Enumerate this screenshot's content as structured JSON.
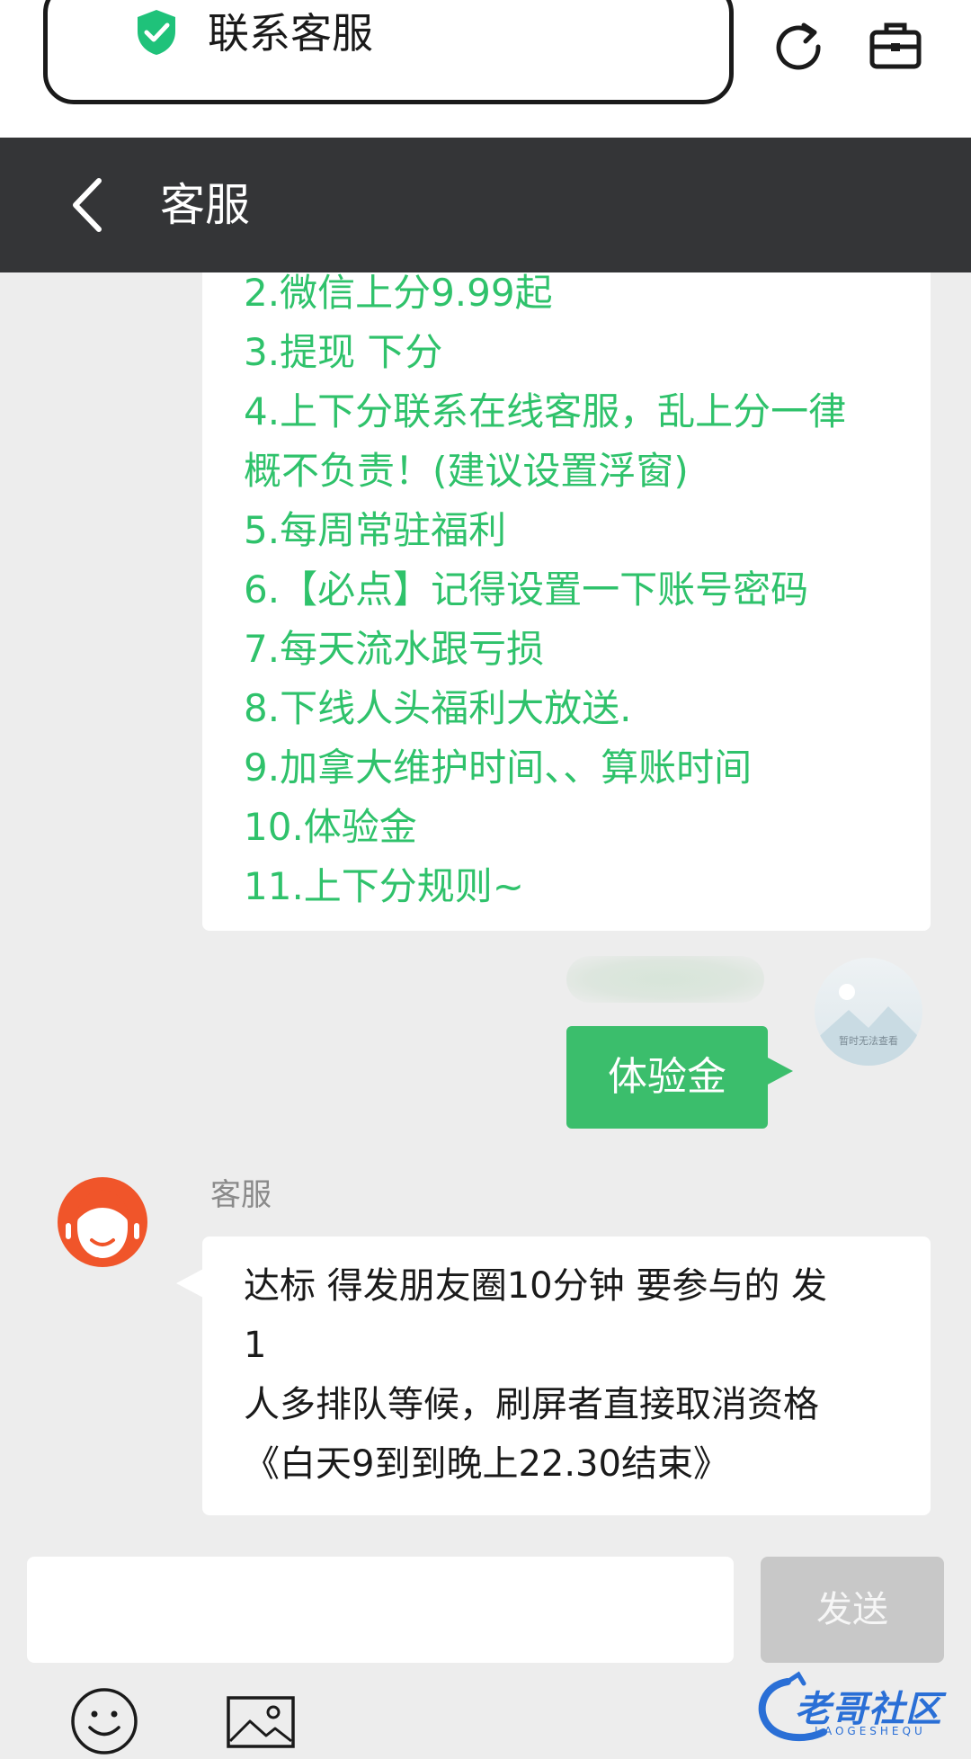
{
  "browser": {
    "title": "联系客服"
  },
  "header": {
    "title": "客服"
  },
  "rules": [
    "2.微信上分9.99起",
    "3.提现 下分",
    "4.上下分联系在线客服，乱上分一律",
    "概不负责！(建议设置浮窗)",
    "5.每周常驻福利",
    "6.【必点】记得设置一下账号密码",
    "7.每天流水跟亏损",
    "8.下线人头福利大放送.",
    "9.加拿大维护时间、、算账时间",
    "10.体验金",
    "11.上下分规则~"
  ],
  "user_avatar": {
    "caption": "暂时无法查看"
  },
  "sent_message": "体验金",
  "agent": {
    "name": "客服",
    "message_lines": [
      "达标 得发朋友圈10分钟 要参与的 发",
      "1",
      "人多排队等候，刷屏者直接取消资格",
      "《白天9到到晚上22.30结束》"
    ]
  },
  "composer": {
    "input_value": "",
    "send_label": "发送"
  },
  "watermark": {
    "text": "老哥社区",
    "sub": "LAOGESHEQU"
  },
  "colors": {
    "accent_green": "#2fc26b",
    "sent_bubble": "#3bbe6c",
    "header_bg": "#343537",
    "agent_orange": "#f0552a"
  }
}
